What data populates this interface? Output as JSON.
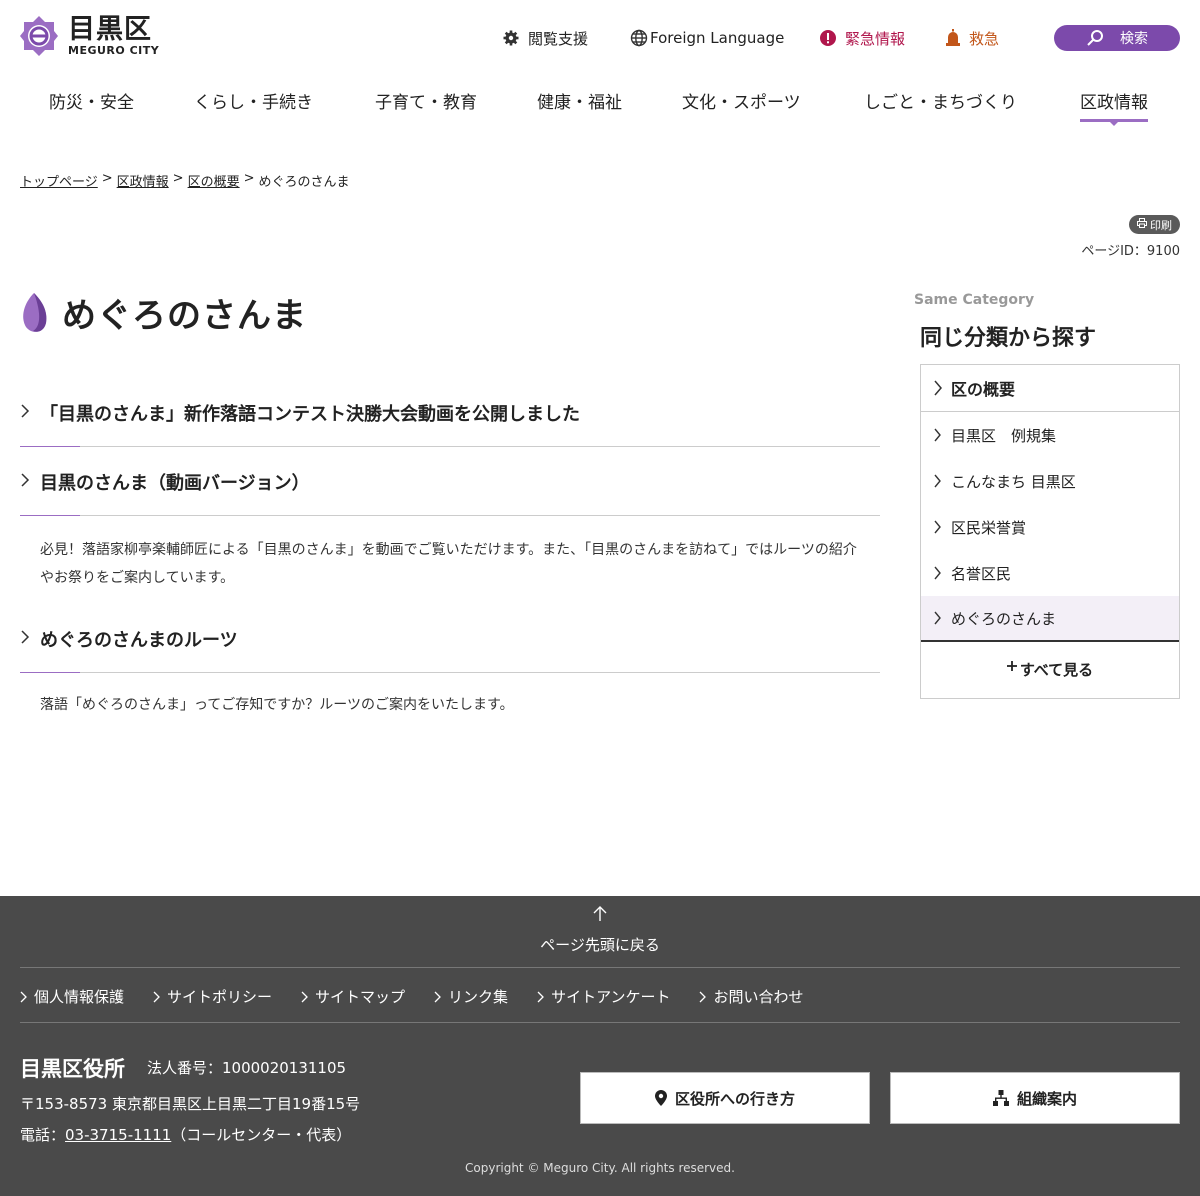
{
  "header": {
    "logo_jp": "目黒区",
    "logo_en": "MEGURO CITY",
    "util": {
      "accessibility": "閲覧支援",
      "foreign": "Foreign Language",
      "alert": "緊急情報",
      "emergency": "救急",
      "search": "検索"
    },
    "nav": [
      {
        "label": "防災・安全"
      },
      {
        "label": "くらし・手続き"
      },
      {
        "label": "子育て・教育"
      },
      {
        "label": "健康・福祉"
      },
      {
        "label": "文化・スポーツ"
      },
      {
        "label": "しごと・まちづくり"
      },
      {
        "label": "区政情報"
      }
    ]
  },
  "breadcrumb": {
    "items": [
      "トップページ",
      "区政情報",
      "区の概要"
    ],
    "sep": ">",
    "current": "めぐろのさんま"
  },
  "page": {
    "print_label": "印刷",
    "page_id": "ページID：9100",
    "title": "めぐろのさんま"
  },
  "entries": [
    {
      "title": "「目黒のさんま」新作落語コンテスト決勝大会動画を公開しました",
      "desc": ""
    },
    {
      "title": "目黒のさんま（動画バージョン）",
      "desc": "必見！落語家柳亭楽輔師匠による「目黒のさんま」を動画でご覧いただけます。また、「目黒のさんまを訪ねて」ではルーツの紹介やお祭りをご案内しています。"
    },
    {
      "title": "めぐろのさんまのルーツ",
      "desc": "落語「めぐろのさんま」ってご存知ですか？ルーツのご案内をいたします。"
    }
  ],
  "sidebar": {
    "en": "Same Category",
    "jp": "同じ分類から探す",
    "head": "区の概要",
    "items": [
      {
        "label": "目黒区　例規集"
      },
      {
        "label": "こんなまち 目黒区"
      },
      {
        "label": "区民栄誉賞"
      },
      {
        "label": "名誉区民"
      },
      {
        "label": "めぐろのさんま"
      }
    ],
    "more": "すべて見る"
  },
  "footer": {
    "totop": "ページ先頭に戻る",
    "links": [
      {
        "label": "個人情報保護"
      },
      {
        "label": "サイトポリシー"
      },
      {
        "label": "サイトマップ"
      },
      {
        "label": "リンク集"
      },
      {
        "label": "サイトアンケート"
      },
      {
        "label": "お問い合わせ"
      }
    ],
    "org": "目黒区役所",
    "corp_no": "法人番号：1000020131105",
    "address": "〒153-8573 東京都目黒区上目黒二丁目19番15号",
    "tel_prefix": "電話：",
    "tel": "03-3715-1111",
    "tel_suffix": "（コールセンター・代表）",
    "btn_access": "区役所への行き方",
    "btn_org": "組織案内",
    "copyright": "Copyright © Meguro City. All rights reserved."
  },
  "colors": {
    "brand_purple": "#7c4aab",
    "accent_purple": "#9b6dc3",
    "alert_red": "#b0164c",
    "emergency_orange": "#c2561a",
    "footer_bg": "#4a4a4a"
  }
}
